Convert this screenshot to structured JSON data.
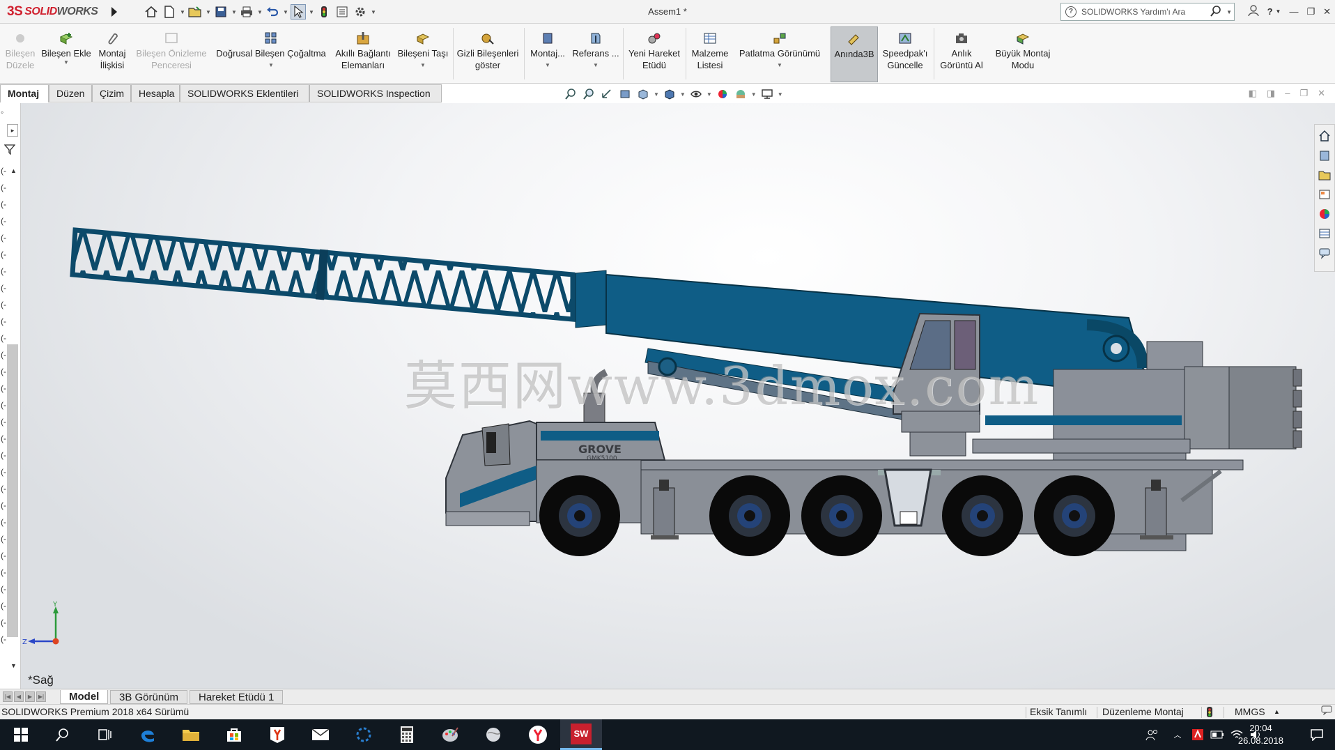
{
  "app": {
    "brand_ds": "3S",
    "brand_solid": "SOLID",
    "brand_works": "WORKS",
    "doc_title": "Assem1 *"
  },
  "help": {
    "search_placeholder": "SOLIDWORKS Yardım'ı Ara"
  },
  "commands": {
    "edit_component": "Bileşen Düzele",
    "insert_component": "Bileşen Ekle",
    "mate": "Montaj İlişkisi",
    "preview_window": "Bileşen Önizleme Penceresi",
    "linear_pattern": "Doğrusal Bileşen Çoğaltma",
    "smart_fasteners": "Akıllı Bağlantı Elemanları",
    "move_component": "Bileşeni Taşı",
    "show_hidden": "Gizli Bileşenleri göster",
    "assembly_features": "Montaj...",
    "reference": "Referans ...",
    "new_motion_study": "Yeni Hareket Etüdü",
    "bom": "Malzeme Listesi",
    "exploded_view": "Patlatma Görünümü",
    "instant3d": "Anında3B",
    "speedpak": "Speedpak'ı Güncelle",
    "snapshot": "Anlık Görüntü Al",
    "large_assembly": "Büyük Montaj Modu"
  },
  "tabs": [
    "Montaj",
    "Düzen",
    "Çizim",
    "Hesapla",
    "SOLIDWORKS Eklentileri",
    "SOLIDWORKS Inspection"
  ],
  "viewport": {
    "view_name": "*Sağ",
    "watermark": "莫西网www.3dmox.com",
    "triad_y": "Y",
    "triad_z": "Z",
    "truck_brand": "GROVE",
    "truck_model": "GMK5100"
  },
  "sheet_tabs": [
    "Model",
    "3B Görünüm",
    "Hareket Etüdü 1"
  ],
  "status": {
    "version": "SOLIDWORKS Premium 2018 x64 Sürümü",
    "under_defined": "Eksik Tanımlı",
    "editing": "Düzenleme Montaj",
    "units": "MMGS"
  },
  "taskbar": {
    "time": "20:04",
    "date": "26.08.2018",
    "sw_badge": "SW"
  }
}
